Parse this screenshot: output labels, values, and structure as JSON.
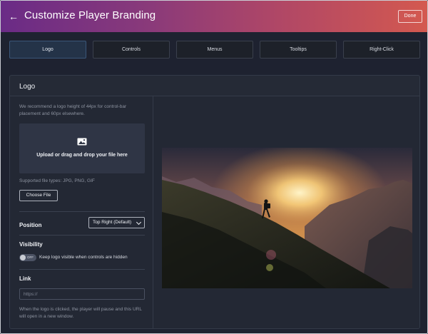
{
  "header": {
    "title": "Customize Player Branding",
    "done_label": "Done",
    "back_icon": "arrow-left-icon"
  },
  "tabs": [
    {
      "label": "Logo",
      "active": true
    },
    {
      "label": "Controls",
      "active": false
    },
    {
      "label": "Menus",
      "active": false
    },
    {
      "label": "Tooltips",
      "active": false
    },
    {
      "label": "Right-Click",
      "active": false
    }
  ],
  "panel": {
    "title": "Logo",
    "help_text": "We recommend a logo height of 44px for control-bar placement and 60px elsewhere.",
    "dropzone": {
      "icon": "image-icon",
      "text": "Upload or drag and drop your file here"
    },
    "supported_types": "Supported file types: JPG, PNG, GIF",
    "choose_file_label": "Choose File",
    "position": {
      "label": "Position",
      "selected": "Top Right (Default)"
    },
    "visibility": {
      "label": "Visibility",
      "toggle_state": "OFF",
      "toggle_text": "Keep logo visible when controls are hidden"
    },
    "link": {
      "label": "Link",
      "placeholder": "https://",
      "value": "",
      "help_text": "When the logo is clicked, the player will pause and this URL will open in a new window."
    }
  },
  "colors": {
    "header_gradient_start": "#6a2b86",
    "header_gradient_end": "#d4594f",
    "active_tab": "#243348",
    "panel_bg": "#232834"
  }
}
